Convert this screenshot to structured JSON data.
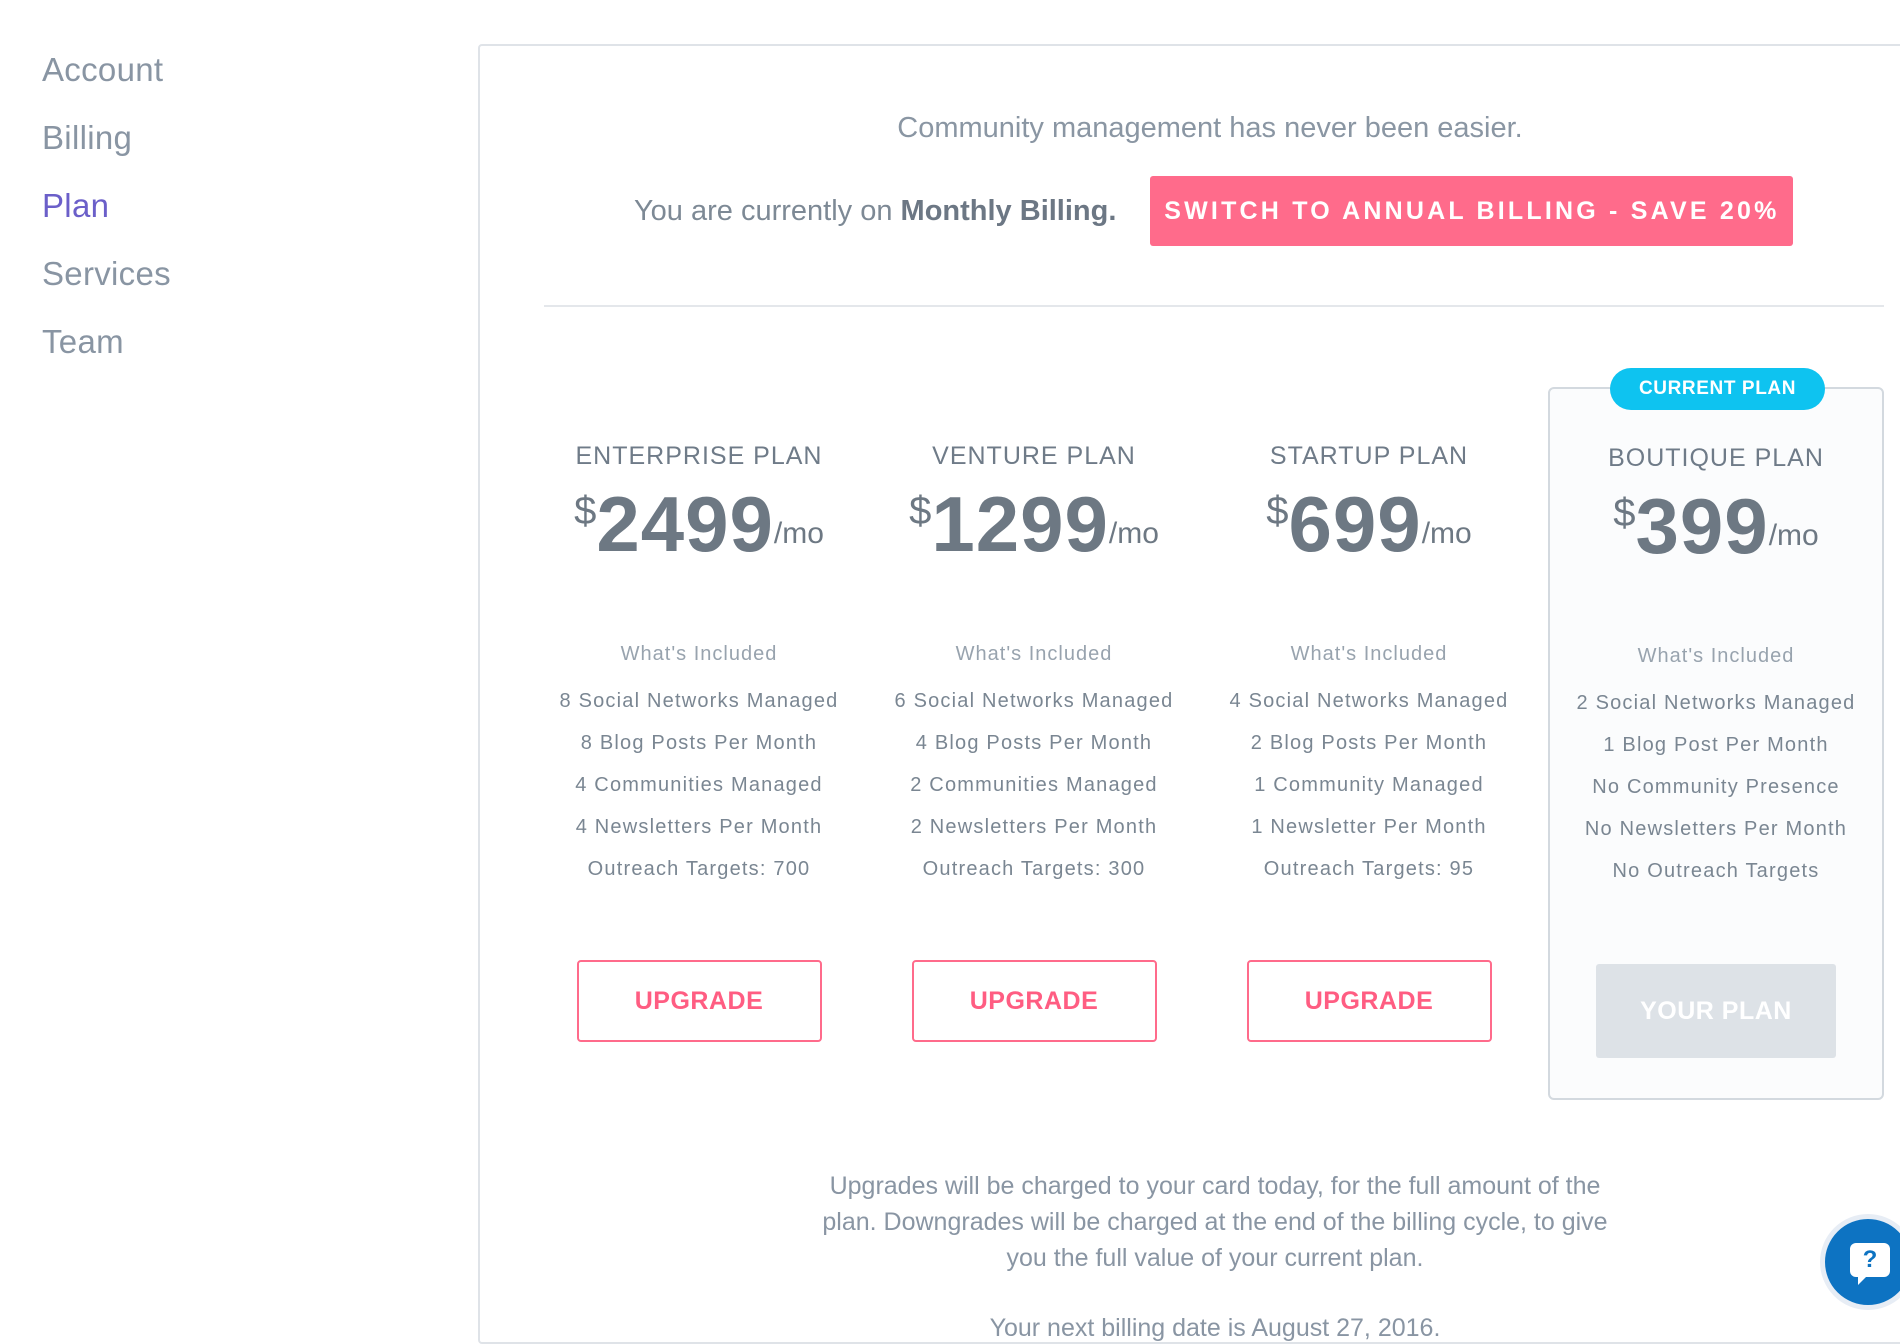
{
  "sidebar": {
    "items": [
      {
        "label": "Account",
        "active": false
      },
      {
        "label": "Billing",
        "active": false
      },
      {
        "label": "Plan",
        "active": true
      },
      {
        "label": "Services",
        "active": false
      },
      {
        "label": "Team",
        "active": false
      }
    ]
  },
  "header": {
    "tagline": "Community management has never been easier.",
    "billing_prefix": "You are currently on",
    "billing_mode": "Monthly Billing.",
    "switch_button": "SWITCH TO ANNUAL BILLING - SAVE 20%"
  },
  "plans": [
    {
      "name": "ENTERPRISE PLAN",
      "currency": "$",
      "price": "2499",
      "period": "/mo",
      "included_label": "What's Included",
      "features": [
        "8 Social Networks Managed",
        "8 Blog Posts Per Month",
        "4 Communities Managed",
        "4 Newsletters Per Month",
        "Outreach Targets: 700"
      ],
      "button": "UPGRADE"
    },
    {
      "name": "VENTURE PLAN",
      "currency": "$",
      "price": "1299",
      "period": "/mo",
      "included_label": "What's Included",
      "features": [
        "6 Social Networks Managed",
        "4 Blog Posts Per Month",
        "2 Communities Managed",
        "2 Newsletters Per Month",
        "Outreach Targets: 300"
      ],
      "button": "UPGRADE"
    },
    {
      "name": "STARTUP PLAN",
      "currency": "$",
      "price": "699",
      "period": "/mo",
      "included_label": "What's Included",
      "features": [
        "4 Social Networks Managed",
        "2 Blog Posts Per Month",
        "1 Community Managed",
        "1 Newsletter Per Month",
        "Outreach Targets: 95"
      ],
      "button": "UPGRADE"
    },
    {
      "name": "BOUTIQUE PLAN",
      "currency": "$",
      "price": "399",
      "period": "/mo",
      "included_label": "What's Included",
      "features": [
        "2 Social Networks Managed",
        "1 Blog Post Per Month",
        "No Community Presence",
        "No Newsletters Per Month",
        "No Outreach Targets"
      ],
      "button": "YOUR PLAN",
      "badge": "CURRENT PLAN"
    }
  ],
  "footer": {
    "note": "Upgrades will be charged to your card today, for the full amount of the plan. Downgrades will be charged at the end of the billing cycle, to give you the full value of your current plan.",
    "next_billing": "Your next billing date is August 27, 2016."
  },
  "help": {
    "icon": "question-chat-icon",
    "glyph": "?"
  },
  "colors": {
    "accent": "#ff6b8b",
    "active_nav": "#6b5fc9",
    "badge": "#0ec3f0",
    "help": "#0d73c2"
  }
}
